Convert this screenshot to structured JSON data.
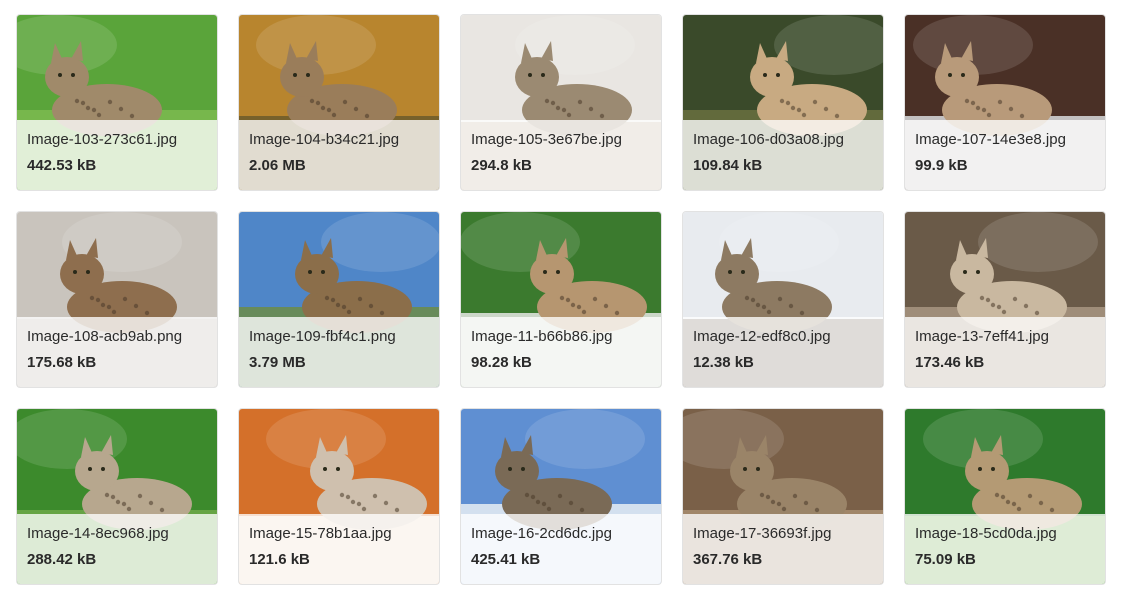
{
  "gallery": {
    "items": [
      {
        "name": "Image-103-273c61.jpg",
        "size": "442.53 kB",
        "icon": "bobcat-photo-icon",
        "colors": {
          "bg": "#5aa43a",
          "mid": "#7dbb50",
          "animal": "#a08a6a"
        }
      },
      {
        "name": "Image-104-b34c21.jpg",
        "size": "2.06 MB",
        "icon": "bobcat-photo-icon",
        "colors": {
          "bg": "#b8852e",
          "mid": "#6b5a2a",
          "animal": "#9a7d5a"
        }
      },
      {
        "name": "Image-105-3e67be.jpg",
        "size": "294.8 kB",
        "icon": "bobcat-photo-icon",
        "colors": {
          "bg": "#e9e6e2",
          "mid": "#b8a38a",
          "animal": "#9b8a72"
        }
      },
      {
        "name": "Image-106-d03a08.jpg",
        "size": "109.84 kB",
        "icon": "lynx-photo-icon",
        "colors": {
          "bg": "#3a4a2a",
          "mid": "#6a7040",
          "animal": "#c8aa82"
        }
      },
      {
        "name": "Image-107-14e3e8.jpg",
        "size": "99.9 kB",
        "icon": "bobcat-photo-icon",
        "colors": {
          "bg": "#4a3026",
          "mid": "#d7d9dc",
          "animal": "#b89a7a"
        }
      },
      {
        "name": "Image-108-acb9ab.png",
        "size": "175.68 kB",
        "icon": "bobcat-photo-icon",
        "colors": {
          "bg": "#c9c4bd",
          "mid": "#b4aca1",
          "animal": "#8e6e4e"
        }
      },
      {
        "name": "Image-109-fbf4c1.png",
        "size": "3.79 MB",
        "icon": "bobcat-photo-icon",
        "colors": {
          "bg": "#4f86c8",
          "mid": "#6c8c46",
          "animal": "#8b6e4a"
        }
      },
      {
        "name": "Image-11-b66b86.jpg",
        "size": "98.28 kB",
        "icon": "bobcat-photo-icon",
        "colors": {
          "bg": "#3b7a2e",
          "mid": "#e6e8e4",
          "animal": "#b69670"
        }
      },
      {
        "name": "Image-12-edf8c0.jpg",
        "size": "12.38 kB",
        "icon": "bobcat-photo-icon",
        "colors": {
          "bg": "#e8ebef",
          "mid": "#5a4a38",
          "animal": "#8d7a62"
        }
      },
      {
        "name": "Image-13-7eff41.jpg",
        "size": "173.46 kB",
        "icon": "bobcat-face-icon",
        "colors": {
          "bg": "#6a5a48",
          "mid": "#a89682",
          "animal": "#c9b8a0"
        }
      },
      {
        "name": "Image-14-8ec968.jpg",
        "size": "288.42 kB",
        "icon": "bobcat-face-icon",
        "colors": {
          "bg": "#3c8a2c",
          "mid": "#6da84a",
          "animal": "#b7a78e"
        }
      },
      {
        "name": "Image-15-78b1aa.jpg",
        "size": "121.6 kB",
        "icon": "lynx-photo-icon",
        "colors": {
          "bg": "#d4702a",
          "mid": "#f2e6dc",
          "animal": "#cfc0ae"
        }
      },
      {
        "name": "Image-16-2cd6dc.jpg",
        "size": "425.41 kB",
        "icon": "bobcat-photo-icon",
        "colors": {
          "bg": "#5f8fd2",
          "mid": "#e8eef4",
          "animal": "#7a6a56"
        }
      },
      {
        "name": "Image-17-36693f.jpg",
        "size": "367.76 kB",
        "icon": "bobcat-photo-icon",
        "colors": {
          "bg": "#7a6048",
          "mid": "#a88d70",
          "animal": "#9a8468"
        }
      },
      {
        "name": "Image-18-5cd0da.jpg",
        "size": "75.09 kB",
        "icon": "bobcat-photo-icon",
        "colors": {
          "bg": "#2e7a2c",
          "mid": "#72b04c",
          "animal": "#b49a74"
        }
      }
    ]
  }
}
